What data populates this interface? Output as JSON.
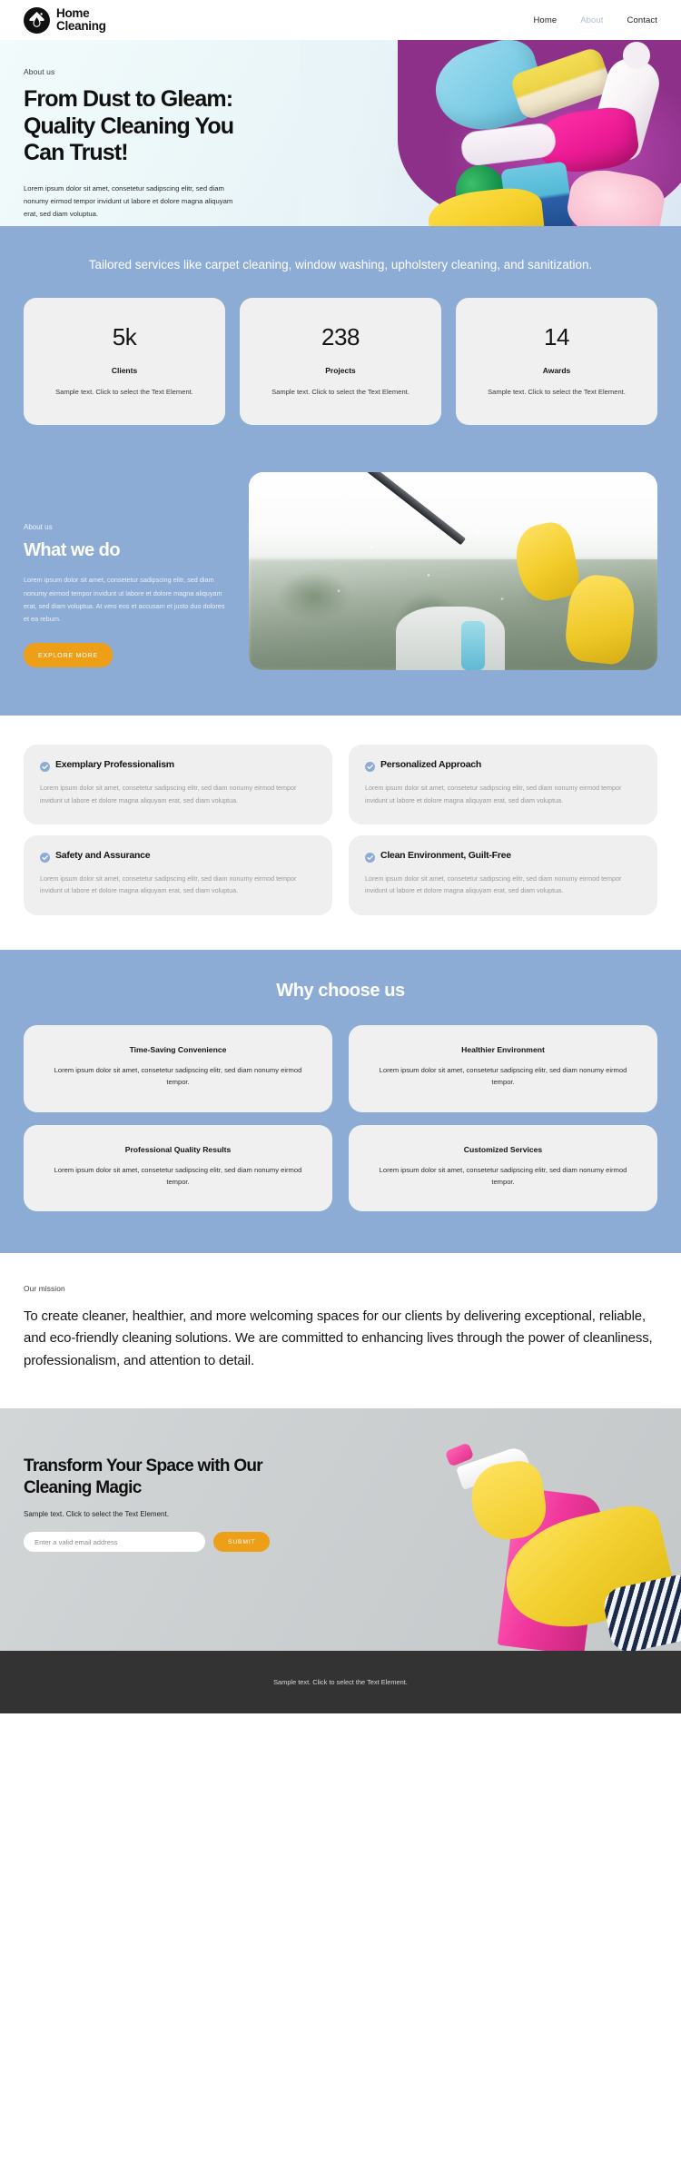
{
  "header": {
    "logo_line1": "Home",
    "logo_line2": "Cleaning",
    "logo_icon": "water-drop-house-icon",
    "nav": [
      {
        "label": "Home",
        "active": false
      },
      {
        "label": "About",
        "active": true
      },
      {
        "label": "Contact",
        "active": false
      }
    ]
  },
  "hero": {
    "eyebrow": "About us",
    "heading": "From Dust to Gleam: Quality Cleaning You Can Trust!",
    "paragraph": "Lorem ipsum dolor sit amet, consetetur sadipscing elitr, sed diam nonumy eirmod tempor invidunt ut labore et dolore magna aliquyam erat, sed diam voluptua.",
    "image_alt": "cleaning-supplies-bucket-photo"
  },
  "tagline": "Tailored services like carpet cleaning, window washing, upholstery cleaning, and sanitization.",
  "stats": [
    {
      "value": "5k",
      "label": "Clients",
      "desc": "Sample text. Click to select the Text Element."
    },
    {
      "value": "238",
      "label": "Projects",
      "desc": "Sample text. Click to select the Text Element."
    },
    {
      "value": "14",
      "label": "Awards",
      "desc": "Sample text. Click to select the Text Element."
    }
  ],
  "whatwedo": {
    "eyebrow": "About us",
    "heading": "What we do",
    "paragraph": "Lorem ipsum dolor sit amet, consetetur sadipscing elitr, sed diam nonumy eirmod tempor invidunt ut labore et dolore magna aliquyam erat, sed diam voluptua. At vero eos et accusam et justo duo dolores et ea rebum.",
    "button_label": "EXPLORE MORE",
    "image_alt": "window-cleaning-squeegee-photo"
  },
  "features": [
    {
      "title": "Exemplary Professionalism",
      "body": "Lorem ipsum dolor sit amet, consetetur sadipscing elitr, sed diam nonumy eirmod tempor invidunt ut labore et dolore magna aliquyam erat, sed diam voluptua."
    },
    {
      "title": "Personalized Approach",
      "body": "Lorem ipsum dolor sit amet, consetetur sadipscing elitr, sed diam nonumy eirmod tempor invidunt ut labore et dolore magna aliquyam erat, sed diam voluptua."
    },
    {
      "title": "Safety and Assurance",
      "body": "Lorem ipsum dolor sit amet, consetetur sadipscing elitr, sed diam nonumy eirmod tempor invidunt ut labore et dolore magna aliquyam erat, sed diam voluptua."
    },
    {
      "title": "Clean Environment, Guilt-Free",
      "body": "Lorem ipsum dolor sit amet, consetetur sadipscing elitr, sed diam nonumy eirmod tempor invidunt ut labore et dolore magna aliquyam erat, sed diam voluptua."
    }
  ],
  "why": {
    "heading": "Why choose us",
    "cards": [
      {
        "title": "Time-Saving Convenience",
        "body": "Lorem ipsum dolor sit amet, consetetur sadipscing elitr, sed diam nonumy eirmod tempor."
      },
      {
        "title": "Healthier Environment",
        "body": "Lorem ipsum dolor sit amet, consetetur sadipscing elitr, sed diam nonumy eirmod tempor."
      },
      {
        "title": "Professional Quality Results",
        "body": "Lorem ipsum dolor sit amet, consetetur sadipscing elitr, sed diam nonumy eirmod tempor."
      },
      {
        "title": "Customized Services",
        "body": "Lorem ipsum dolor sit amet, consetetur sadipscing elitr, sed diam nonumy eirmod tempor."
      }
    ]
  },
  "mission": {
    "eyebrow": "Our mission",
    "text": "To create cleaner, healthier, and more welcoming spaces for our clients by delivering exceptional, reliable, and eco-friendly cleaning solutions. We are committed to enhancing lives through the power of cleanliness, professionalism, and attention to detail."
  },
  "cta": {
    "heading": "Transform Your Space with Our Cleaning Magic",
    "subtext": "Sample text. Click to select the Text Element.",
    "email_placeholder": "Enter a valid email address",
    "email_value": "",
    "submit_label": "SUBMIT",
    "image_alt": "yellow-glove-holding-pink-spray-bottle-photo"
  },
  "footer": {
    "text": "Sample text. Click to select the Text Element."
  },
  "colors": {
    "blue_band": "#8cacd6",
    "accent_orange": "#eda017",
    "card_grey": "#f0f0f0",
    "footer_dark": "#333333",
    "check_blue": "#8cacd6"
  }
}
